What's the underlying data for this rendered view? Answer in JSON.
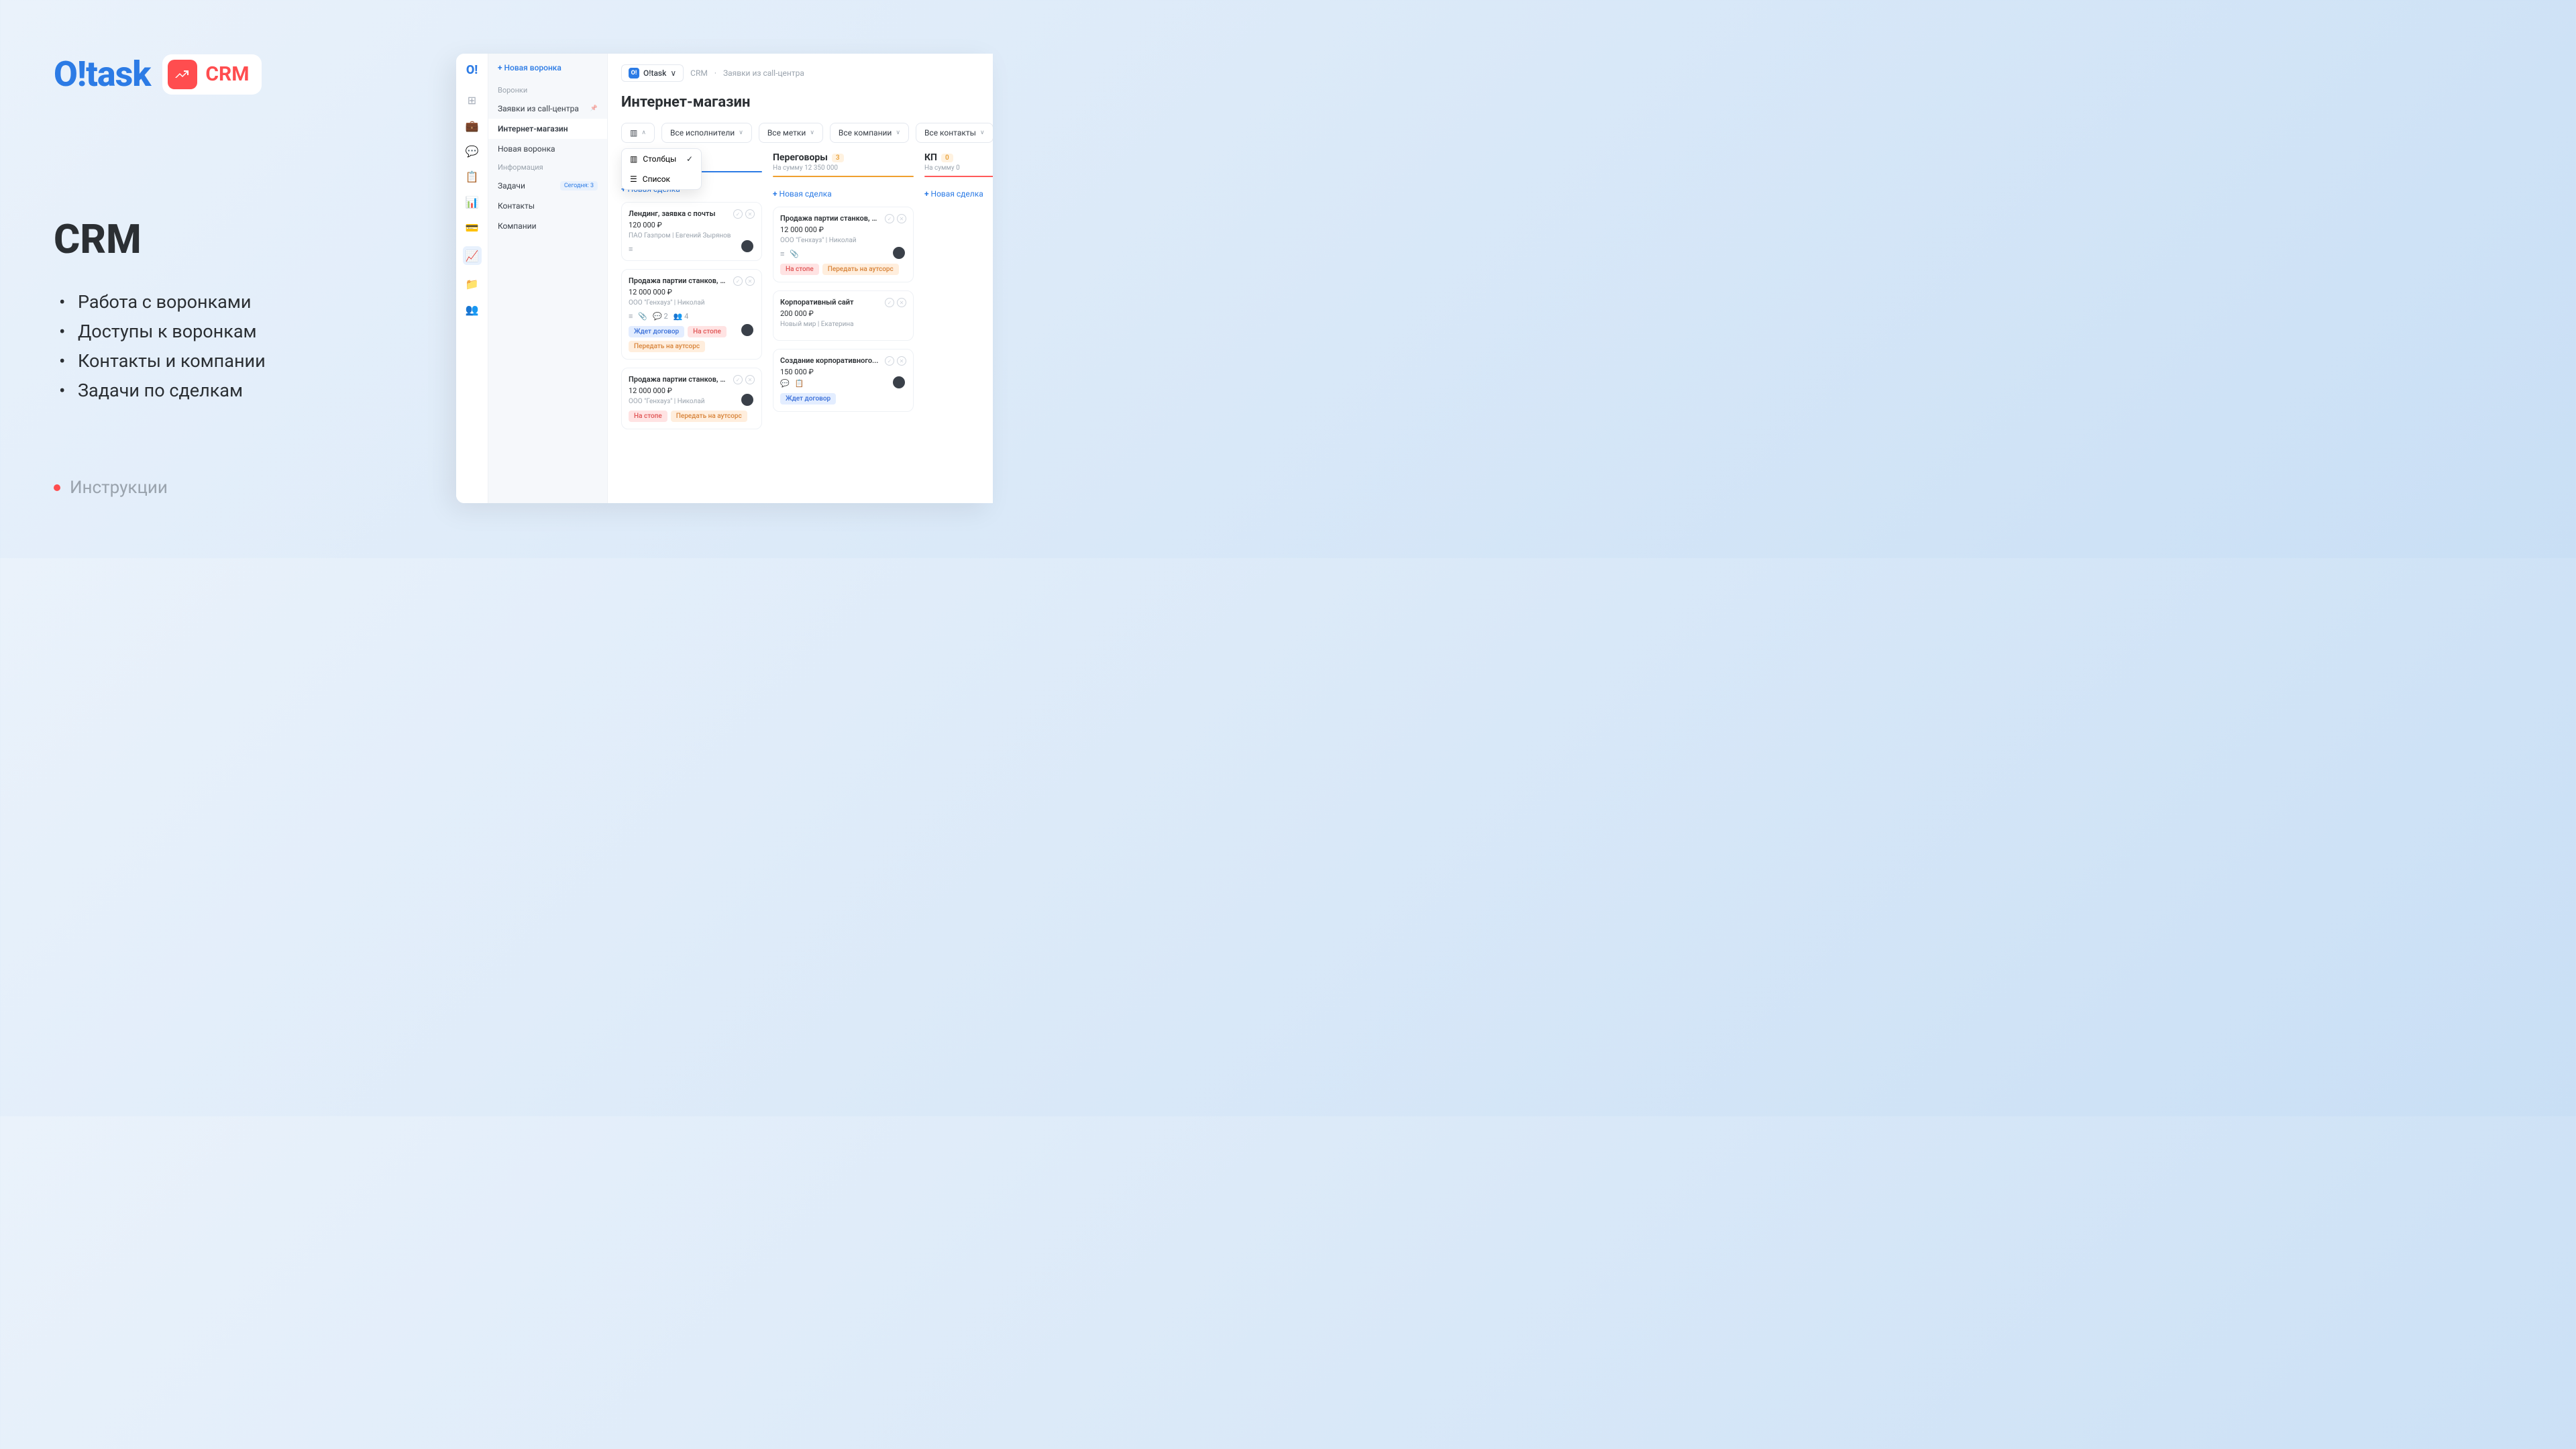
{
  "brand": {
    "logo": "O!task",
    "badge": "CRM"
  },
  "heading": "CRM",
  "bullets": [
    "Работа с воронками",
    "Доступы к воронкам",
    "Контакты и компании",
    "Задачи по сделкам"
  ],
  "footer": "Инструкции",
  "app": {
    "logo": "O!",
    "sidebar_new": "Новая воронка",
    "section_funnels": "Воронки",
    "funnels": [
      {
        "label": "Заявки из call-центра",
        "pinned": true
      },
      {
        "label": "Интернет-магазин",
        "active": true
      },
      {
        "label": "Новая воронка"
      }
    ],
    "section_info": "Информация",
    "info": [
      {
        "label": "Задачи",
        "badge": "Сегодня: 3"
      },
      {
        "label": "Контакты"
      },
      {
        "label": "Компании"
      }
    ],
    "workspace": "O!task",
    "breadcrumb": [
      "CRM",
      "Заявки из call-центра"
    ],
    "page_title": "Интернет-магазин",
    "filters": [
      "Все исполнители",
      "Все метки",
      "Все компании",
      "Все контакты"
    ],
    "view_dropdown": [
      {
        "label": "Столбцы",
        "checked": true
      },
      {
        "label": "Список"
      }
    ],
    "new_deal": "Новая сделка",
    "columns": [
      {
        "title": "",
        "badge": "",
        "sub": "",
        "color": "c-blue",
        "cards": [
          {
            "title": "Лендинг, заявка с почты",
            "price": "120 000 ₽",
            "meta": "ПАО Газпром | Евгений Зырянов",
            "icons": [
              "≡"
            ],
            "tags": [],
            "avatar": true,
            "avatar_low": true
          },
          {
            "title": "Продажа партии станков, 1...",
            "price": "12 000 000 ₽",
            "meta": "ООО \"Генхауз\" | Николай",
            "icons": [
              "≡",
              "📎",
              "💬 2",
              "👥 4"
            ],
            "tags": [
              {
                "t": "Ждет договор",
                "c": "tag-blue"
              },
              {
                "t": "На стопе",
                "c": "tag-red"
              },
              {
                "t": "Передать на аутсорс",
                "c": "tag-orange"
              }
            ],
            "avatar": true
          },
          {
            "title": "Продажа партии станков, 1...",
            "price": "12 000 000 ₽",
            "meta": "ООО \"Генхауз\" | Николай",
            "icons": [],
            "tags": [
              {
                "t": "На стопе",
                "c": "tag-red"
              },
              {
                "t": "Передать на аутсорс",
                "c": "tag-orange"
              }
            ],
            "avatar": true
          }
        ]
      },
      {
        "title": "Переговоры",
        "badge": "3",
        "sub": "На сумму 12 350 000",
        "color": "c-orange",
        "cards": [
          {
            "title": "Продажа партии станков, 1...",
            "price": "12 000 000 ₽",
            "meta": "ООО \"Генхауз\" | Николай",
            "icons": [
              "≡",
              "📎"
            ],
            "tags": [
              {
                "t": "На стопе",
                "c": "tag-red"
              },
              {
                "t": "Передать на аутсорс",
                "c": "tag-orange"
              }
            ],
            "avatar": true
          },
          {
            "title": "Корпоративный сайт",
            "price": "200 000 ₽",
            "meta": "Новый мир | Екатерина",
            "icons": [],
            "tags": [],
            "avatar": false
          },
          {
            "title": "Создание корпоративного...",
            "price": "150 000 ₽",
            "meta": "",
            "icons": [
              "💬",
              "📋"
            ],
            "tags": [
              {
                "t": "Ждет договор",
                "c": "tag-blue"
              }
            ],
            "avatar": true
          }
        ]
      },
      {
        "title": "КП",
        "badge": "0",
        "sub": "На сумму 0",
        "color": "c-red",
        "cards": []
      }
    ]
  }
}
